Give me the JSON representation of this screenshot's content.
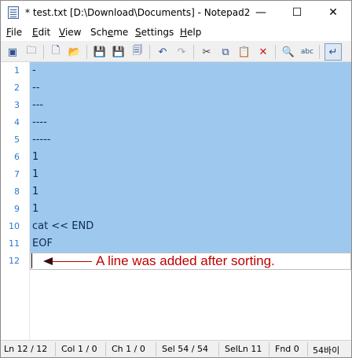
{
  "window": {
    "title": "* test.txt [D:\\Download\\Documents] - Notepad2",
    "controls": {
      "minimize": "—",
      "maximize": "☐",
      "close": "✕"
    }
  },
  "menu": [
    {
      "accel": "F",
      "rest": "ile"
    },
    {
      "accel": "E",
      "rest": "dit"
    },
    {
      "accel": "V",
      "rest": "iew"
    },
    {
      "accel": "",
      "rest": "Sch",
      "accel2": "e",
      "rest2": "me"
    },
    {
      "accel": "S",
      "rest": "ettings"
    },
    {
      "accel": "H",
      "rest": "elp"
    }
  ],
  "toolbar": [
    {
      "name": "new-window-icon",
      "glyph": "▣"
    },
    {
      "name": "browse-icon",
      "glyph": "🗀"
    },
    {
      "name": "new-file-icon",
      "glyph": "🗋"
    },
    {
      "name": "open-file-icon",
      "glyph": "📂"
    },
    {
      "name": "save-icon",
      "glyph": "💾"
    },
    {
      "name": "save-as-icon",
      "glyph": "💾"
    },
    {
      "name": "save-all-icon",
      "glyph": "🗐"
    },
    {
      "name": "undo-icon",
      "glyph": "↶"
    },
    {
      "name": "redo-icon",
      "glyph": "↷"
    },
    {
      "name": "cut-icon",
      "glyph": "✂"
    },
    {
      "name": "copy-icon",
      "glyph": "⧉"
    },
    {
      "name": "paste-icon",
      "glyph": "📋"
    },
    {
      "name": "delete-icon",
      "glyph": "✕"
    },
    {
      "name": "find-icon",
      "glyph": "🔍"
    },
    {
      "name": "replace-icon",
      "glyph": "abc"
    },
    {
      "name": "word-wrap-icon",
      "glyph": "↵"
    }
  ],
  "editor": {
    "lines": [
      {
        "num": "1",
        "text": "-",
        "selected": true
      },
      {
        "num": "2",
        "text": "--",
        "selected": true
      },
      {
        "num": "3",
        "text": "---",
        "selected": true
      },
      {
        "num": "4",
        "text": "----",
        "selected": true
      },
      {
        "num": "5",
        "text": "-----",
        "selected": true
      },
      {
        "num": "6",
        "text": "1",
        "selected": true
      },
      {
        "num": "7",
        "text": "1",
        "selected": true
      },
      {
        "num": "8",
        "text": "1",
        "selected": true
      },
      {
        "num": "9",
        "text": "1",
        "selected": true
      },
      {
        "num": "10",
        "text": "cat << END",
        "selected": true
      },
      {
        "num": "11",
        "text": "EOF",
        "selected": true
      },
      {
        "num": "12",
        "text": "",
        "selected": false
      }
    ],
    "annotation": "A line was added after sorting."
  },
  "statusbar": {
    "ln": "Ln 12 / 12",
    "col": "Col 1 / 0",
    "ch": "Ch 1 / 0",
    "sel": "Sel 54 / 54",
    "selln": "SelLn 11",
    "fnd": "Fnd 0",
    "size": "54바이"
  },
  "colors": {
    "selection": "#9fc8ee",
    "line_number": "#2b7bd0",
    "annotation": "#c00000"
  }
}
